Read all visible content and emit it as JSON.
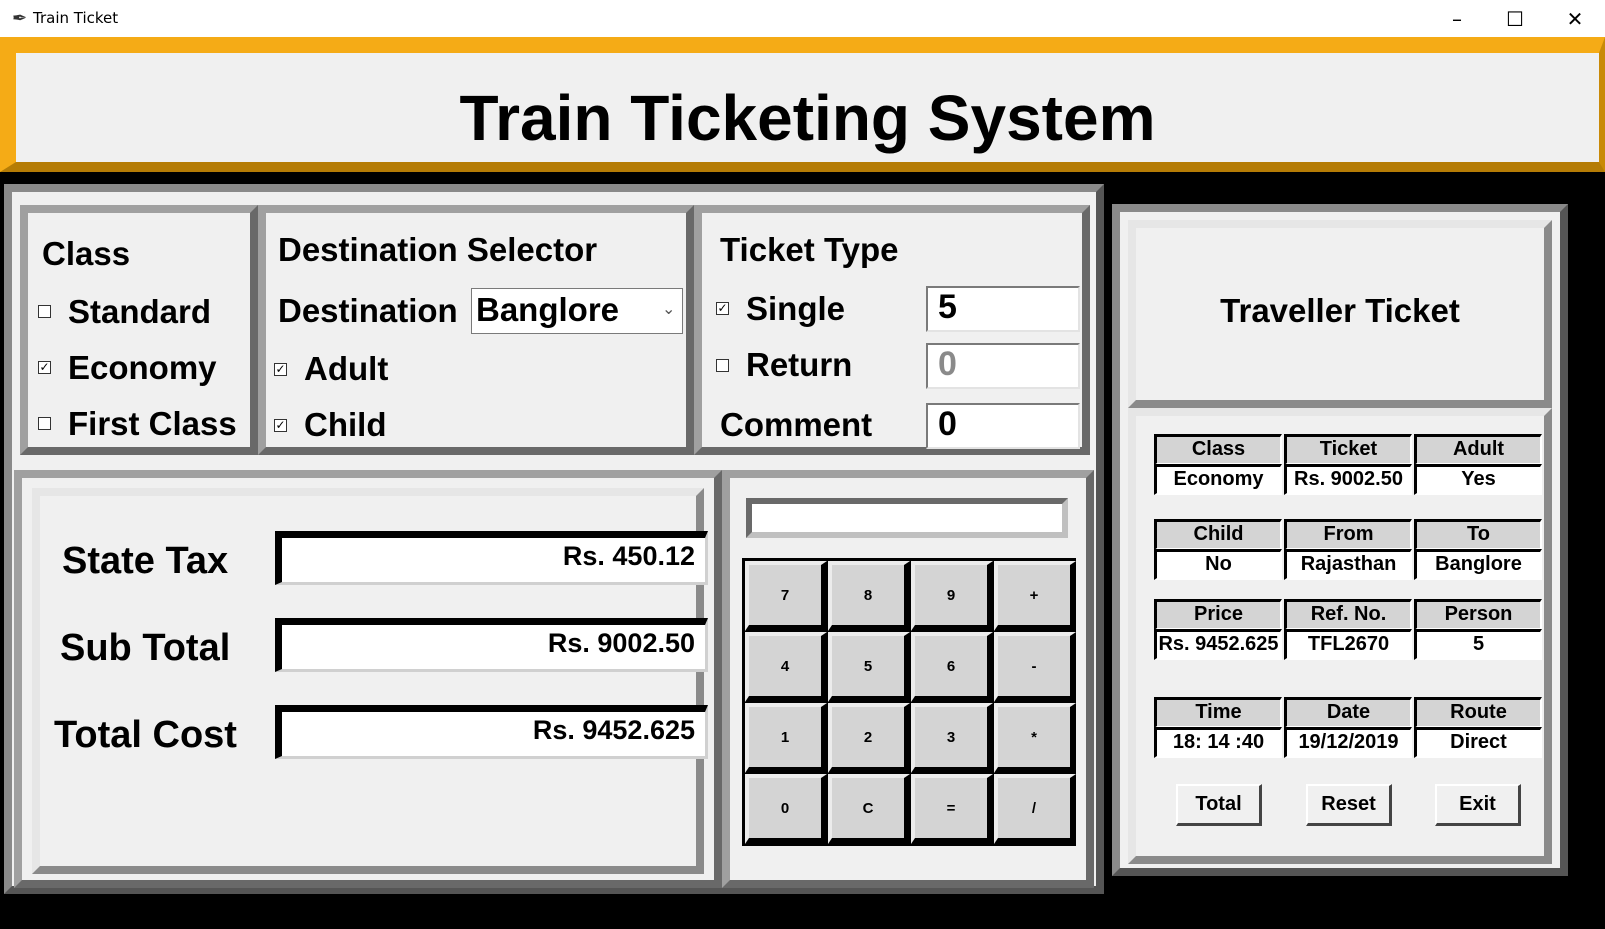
{
  "window": {
    "title": "Train Ticket",
    "minimize": "–",
    "maximize": "☐",
    "close": "✕"
  },
  "header": {
    "title": "Train Ticketing System"
  },
  "class_panel": {
    "heading": "Class",
    "options": [
      {
        "label": "Standard",
        "checked": false
      },
      {
        "label": "Economy",
        "checked": true
      },
      {
        "label": "First Class",
        "checked": false
      }
    ]
  },
  "destination_panel": {
    "heading": "Destination Selector",
    "destination_label": "Destination",
    "destination_value": "Banglore",
    "adult_label": "Adult",
    "adult_checked": true,
    "child_label": "Child",
    "child_checked": true
  },
  "ticket_type_panel": {
    "heading": "Ticket Type",
    "single_label": "Single",
    "single_checked": true,
    "single_value": "5",
    "return_label": "Return",
    "return_checked": false,
    "return_value": "0",
    "comment_label": "Comment",
    "comment_value": "0"
  },
  "costs": {
    "state_tax_label": "State Tax",
    "state_tax_value": "Rs. 450.12",
    "sub_total_label": "Sub Total",
    "sub_total_value": "Rs. 9002.50",
    "total_cost_label": "Total Cost",
    "total_cost_value": "Rs. 9452.625"
  },
  "calculator": {
    "display": "",
    "keys": [
      "7",
      "8",
      "9",
      "+",
      "4",
      "5",
      "6",
      "-",
      "1",
      "2",
      "3",
      "*",
      "0",
      "C",
      "=",
      "/"
    ]
  },
  "ticket": {
    "heading": "Traveller Ticket",
    "headers1": [
      "Class",
      "Ticket",
      "Adult"
    ],
    "values1": [
      "Economy",
      "Rs. 9002.50",
      "Yes"
    ],
    "headers2": [
      "Child",
      "From",
      "To"
    ],
    "values2": [
      "No",
      "Rajasthan",
      "Banglore"
    ],
    "headers3": [
      "Price",
      "Ref. No.",
      "Person"
    ],
    "values3": [
      "Rs. 9452.625",
      "TFL2670",
      "5"
    ],
    "headers4": [
      "Time",
      "Date",
      "Route"
    ],
    "values4": [
      "18: 14 :40",
      "19/12/2019",
      "Direct"
    ],
    "buttons": {
      "total": "Total",
      "reset": "Reset",
      "exit": "Exit"
    }
  }
}
